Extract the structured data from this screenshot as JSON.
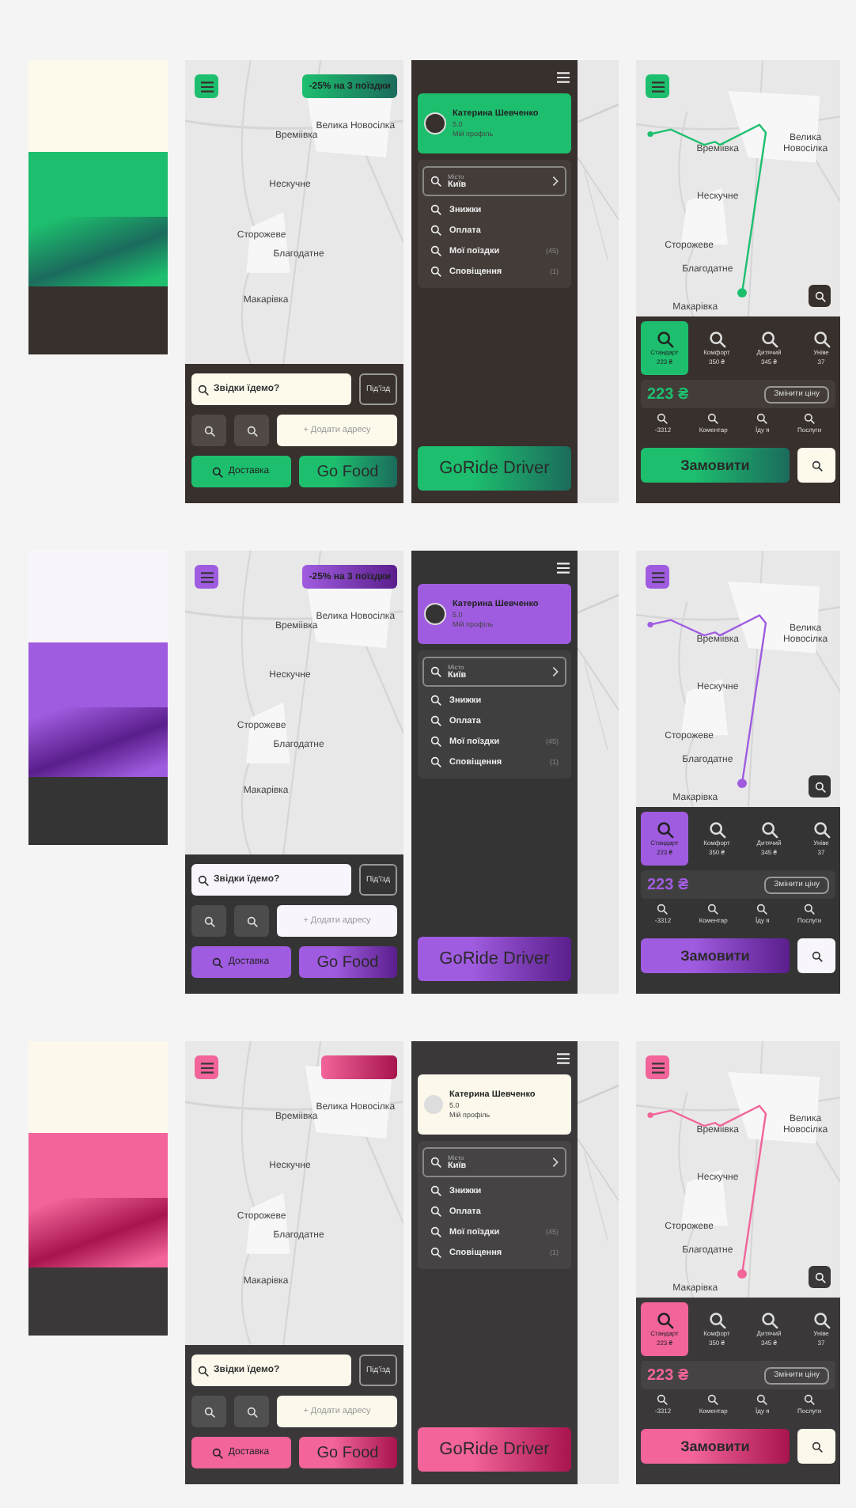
{
  "themes": [
    {
      "palette": [
        {
          "kind": "solid",
          "color": "#fdfaec"
        },
        {
          "kind": "solid",
          "color": "#1dbf6e"
        },
        {
          "kind": "gradient",
          "color": "#1b6b5c"
        },
        {
          "kind": "solid",
          "color": "#38302d"
        }
      ],
      "home": {
        "promo": {
          "shown": true,
          "label": "-25% на 3 поїздки"
        },
        "map_labels": [
          "Времіівка",
          "Велика Новосілка",
          "Нескучне",
          "Сторожеве",
          "Благодатне",
          "Макарівка"
        ],
        "search_placeholder": "Звідки їдемо?",
        "entrance": "Під'їзд",
        "add_address": "+ Додати адресу",
        "delivery": "Доставка",
        "food": "Go Food"
      },
      "menu": {
        "profile": {
          "name": "Катерина Шевченко",
          "rating": "5.0",
          "link": "Мій профіль",
          "highlighted": true
        },
        "city": {
          "label": "Місто",
          "value": "Київ"
        },
        "items": [
          {
            "label": "Знижки"
          },
          {
            "label": "Оплата"
          },
          {
            "label": "Мої поїздки",
            "count": "(45)"
          },
          {
            "label": "Сповіщення",
            "count": "(1)"
          }
        ],
        "driver": "GoRide Driver"
      },
      "order": {
        "map_labels": [
          "Времіівка",
          "Велика Новосілка",
          "Нескучне",
          "Сторожеве",
          "Благодатне",
          "Макарівка"
        ],
        "tariffs": [
          {
            "name": "Стандарт",
            "price": "223 ₴",
            "selected": true
          },
          {
            "name": "Комфорт",
            "price": "350 ₴",
            "selected": false
          },
          {
            "name": "Дитячий",
            "price": "345 ₴",
            "selected": false
          },
          {
            "name": "Уніве",
            "price": "37",
            "selected": false
          }
        ],
        "price": "223 ₴",
        "change_price": "Змінити ціну",
        "options": [
          "-3312",
          "Коментар",
          "Їду я",
          "Послуги"
        ],
        "order_button": "Замовити"
      }
    },
    {
      "palette": [
        {
          "kind": "solid",
          "color": "#f8f6fc"
        },
        {
          "kind": "solid",
          "color": "#a05ce0"
        },
        {
          "kind": "gradient",
          "color": "#5a1e8c"
        },
        {
          "kind": "solid",
          "color": "#343434"
        }
      ],
      "home": {
        "promo": {
          "shown": true,
          "label": "-25% на 3 поїздки"
        },
        "map_labels": [
          "Времіівка",
          "Велика Новосілка",
          "Нескучне",
          "Сторожеве",
          "Благодатне",
          "Макарівка"
        ],
        "search_placeholder": "Звідки їдемо?",
        "entrance": "Під'їзд",
        "add_address": "+ Додати адресу",
        "delivery": "Доставка",
        "food": "Go Food"
      },
      "menu": {
        "profile": {
          "name": "Катерина Шевченко",
          "rating": "5.0",
          "link": "Мій профіль",
          "highlighted": true
        },
        "city": {
          "label": "Місто",
          "value": "Київ"
        },
        "items": [
          {
            "label": "Знижки"
          },
          {
            "label": "Оплата"
          },
          {
            "label": "Мої поїздки",
            "count": "(45)"
          },
          {
            "label": "Сповіщення",
            "count": "(1)"
          }
        ],
        "driver": "GoRide Driver"
      },
      "order": {
        "map_labels": [
          "Времіівка",
          "Велика Новосілка",
          "Нескучне",
          "Сторожеве",
          "Благодатне",
          "Макарівка"
        ],
        "tariffs": [
          {
            "name": "Стандарт",
            "price": "223 ₴",
            "selected": true
          },
          {
            "name": "Комфорт",
            "price": "350 ₴",
            "selected": false
          },
          {
            "name": "Дитячий",
            "price": "345 ₴",
            "selected": false
          },
          {
            "name": "Уніве",
            "price": "37",
            "selected": false
          }
        ],
        "price": "223 ₴",
        "change_price": "Змінити ціну",
        "options": [
          "-3312",
          "Коментар",
          "Їду я",
          "Послуги"
        ],
        "order_button": "Замовити"
      }
    },
    {
      "palette": [
        {
          "kind": "solid",
          "color": "#fcf9ec"
        },
        {
          "kind": "solid",
          "color": "#f2649a"
        },
        {
          "kind": "gradient",
          "color": "#a8144e"
        },
        {
          "kind": "solid",
          "color": "#3a3839"
        }
      ],
      "home": {
        "promo": {
          "shown": true
        },
        "map_labels": [
          "Времіівка",
          "Велика Новосілка",
          "Нескучне",
          "Сторожеве",
          "Благодатне",
          "Макарівка"
        ],
        "search_placeholder": "Звідки їдемо?",
        "entrance": "Під'їзд",
        "add_address": "+ Додати адресу",
        "delivery": "Доставка",
        "food": "Go Food"
      },
      "menu": {
        "profile": {
          "name": "Катерина Шевченко",
          "rating": "5.0",
          "link": "Мій профіль",
          "highlighted": false
        },
        "city": {
          "label": "Місто",
          "value": "Київ"
        },
        "items": [
          {
            "label": "Знижки"
          },
          {
            "label": "Оплата"
          },
          {
            "label": "Мої поїздки",
            "count": "(45)"
          },
          {
            "label": "Сповіщення",
            "count": "(1)"
          }
        ],
        "driver": "GoRide Driver"
      },
      "order": {
        "map_labels": [
          "Времіівка",
          "Велика Новосілка",
          "Нескучне",
          "Сторожеве",
          "Благодатне",
          "Макарівка"
        ],
        "tariffs": [
          {
            "name": "Стандарт",
            "price": "223 ₴",
            "selected": true
          },
          {
            "name": "Комфорт",
            "price": "350 ₴",
            "selected": false
          },
          {
            "name": "Дитячий",
            "price": "345 ₴",
            "selected": false
          },
          {
            "name": "Уніве",
            "price": "37",
            "selected": false
          }
        ],
        "price": "223 ₴",
        "change_price": "Змінити ціну",
        "options": [
          "-3312",
          "Коментар",
          "Їду я",
          "Послуги"
        ],
        "order_button": "Замовити"
      }
    }
  ]
}
